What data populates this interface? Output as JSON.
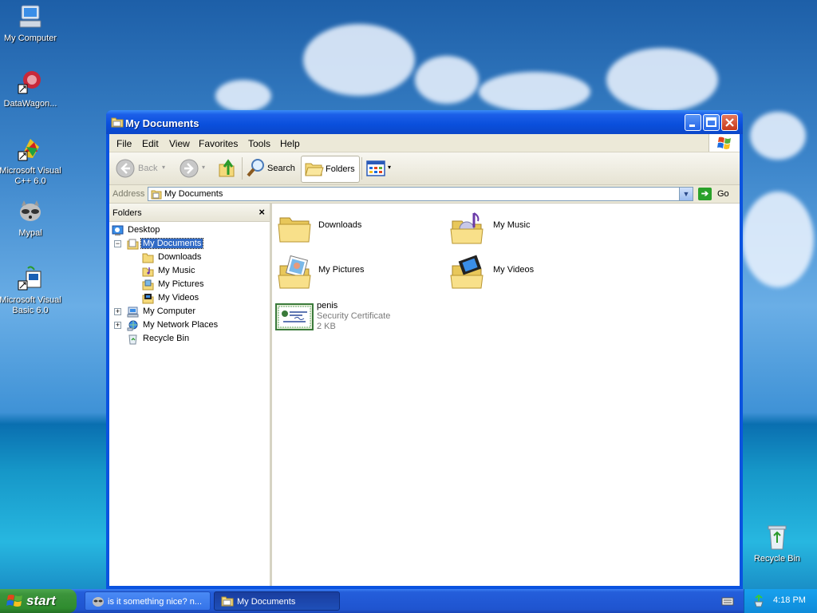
{
  "desktop": {
    "icons": [
      {
        "label": "My Computer"
      },
      {
        "label": "DataWagon..."
      },
      {
        "label": "Microsoft Visual C++ 6.0"
      },
      {
        "label": "Mypal"
      },
      {
        "label": "Microsoft Visual Basic 6.0"
      },
      {
        "label": "Recycle Bin"
      }
    ]
  },
  "window": {
    "title": "My Documents",
    "menu": [
      "File",
      "Edit",
      "View",
      "Favorites",
      "Tools",
      "Help"
    ],
    "toolbar": {
      "back": "Back",
      "search": "Search",
      "folders": "Folders"
    },
    "address": {
      "label": "Address",
      "value": "My Documents",
      "go": "Go"
    },
    "folders_pane": {
      "title": "Folders",
      "close": "×",
      "tree": [
        {
          "label": "Desktop"
        },
        {
          "label": "My Documents"
        },
        {
          "label": "Downloads"
        },
        {
          "label": "My Music"
        },
        {
          "label": "My Pictures"
        },
        {
          "label": "My Videos"
        },
        {
          "label": "My Computer"
        },
        {
          "label": "My Network Places"
        },
        {
          "label": "Recycle Bin"
        }
      ]
    },
    "files": [
      {
        "name": "Downloads"
      },
      {
        "name": "My Music"
      },
      {
        "name": "My Pictures"
      },
      {
        "name": "My Videos"
      },
      {
        "name": "penis",
        "type": "Security Certificate",
        "size": "2 KB"
      }
    ]
  },
  "taskbar": {
    "start": "start",
    "tasks": [
      {
        "label": "is it something nice? n..."
      },
      {
        "label": "My Documents"
      }
    ],
    "clock": "4:18 PM"
  }
}
